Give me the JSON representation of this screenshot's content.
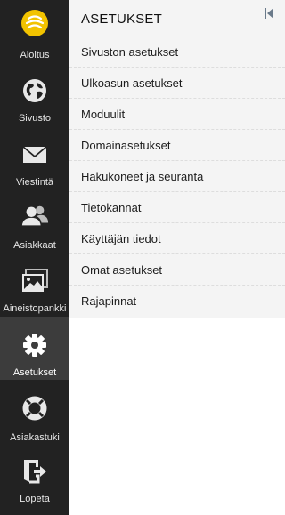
{
  "sidebar": {
    "items": [
      {
        "label": "Aloitus",
        "icon": "logo-icon"
      },
      {
        "label": "Sivusto",
        "icon": "globe-icon"
      },
      {
        "label": "Viestintä",
        "icon": "envelope-icon"
      },
      {
        "label": "Asiakkaat",
        "icon": "users-icon"
      },
      {
        "label": "Aineistopankki",
        "icon": "images-icon"
      },
      {
        "label": "Asetukset",
        "icon": "gear-icon",
        "active": true
      },
      {
        "label": "Asiakastuki",
        "icon": "lifebuoy-icon"
      },
      {
        "label": "Lopeta",
        "icon": "logout-icon"
      }
    ]
  },
  "panel": {
    "title": "ASETUKSET",
    "collapse_icon": "collapse-left-icon",
    "items": [
      "Sivuston asetukset",
      "Ulkoasun asetukset",
      "Moduulit",
      "Domainasetukset",
      "Hakukoneet ja seuranta",
      "Tietokannat",
      "Käyttäjän tiedot",
      "Omat asetukset",
      "Rajapinnat"
    ]
  },
  "colors": {
    "sidebar_bg": "#222222",
    "sidebar_active_bg": "#3c3c3c",
    "logo_yellow": "#f2c300",
    "panel_bg": "#f4f4f4"
  }
}
